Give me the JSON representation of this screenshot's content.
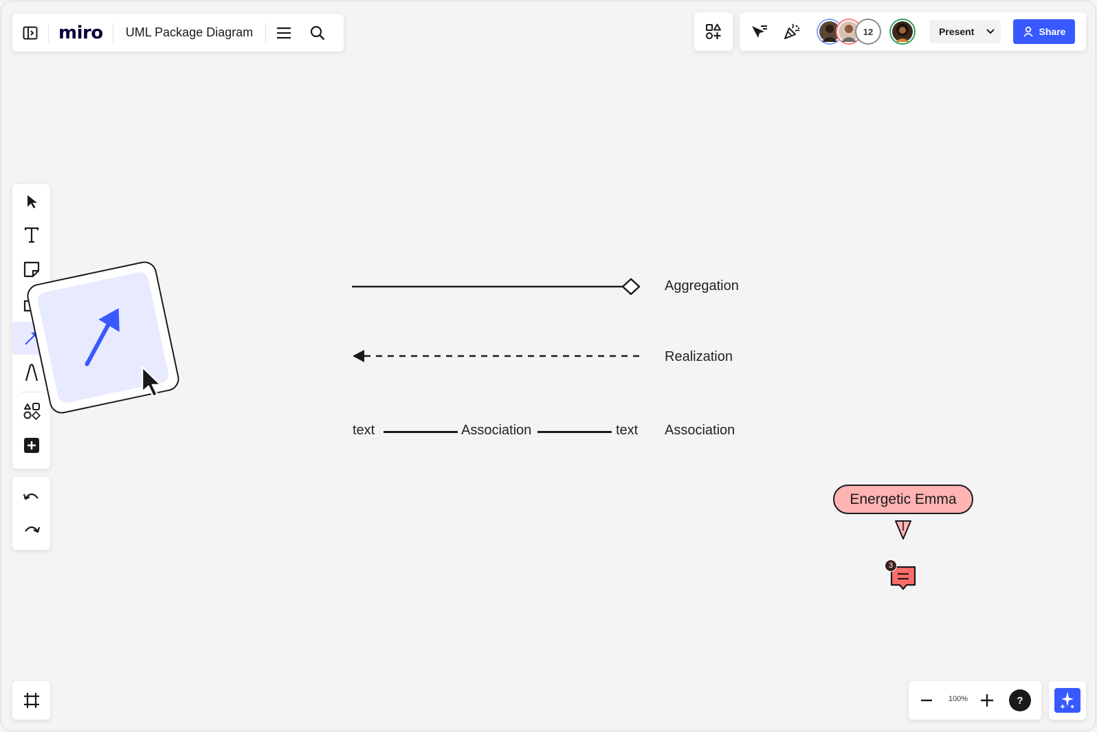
{
  "app": {
    "logo": "miro",
    "board_title": "UML Package Diagram"
  },
  "header": {
    "collaborator_count": "12",
    "present_label": "Present",
    "share_label": "Share"
  },
  "toolbar": {
    "tools": [
      "select",
      "text",
      "sticky-note",
      "shapes",
      "connection-line",
      "pen",
      "templates",
      "more"
    ],
    "active_tool": "connection-line"
  },
  "zoom": {
    "level": "100%"
  },
  "canvas": {
    "legend": [
      {
        "kind": "aggregation",
        "label": "Aggregation"
      },
      {
        "kind": "realization",
        "label": "Realization"
      },
      {
        "kind": "association",
        "label": "Association"
      }
    ],
    "association_line": {
      "left_text": "text",
      "middle_text": "Association",
      "right_text": "text"
    },
    "cursor_user": "Energetic Emma",
    "comment_count": "3"
  },
  "colors": {
    "brand": "#3859ff",
    "accent_light": "#e8ebff",
    "cursor_tag": "#ffb3b3",
    "comment": "#ff6b6b"
  }
}
